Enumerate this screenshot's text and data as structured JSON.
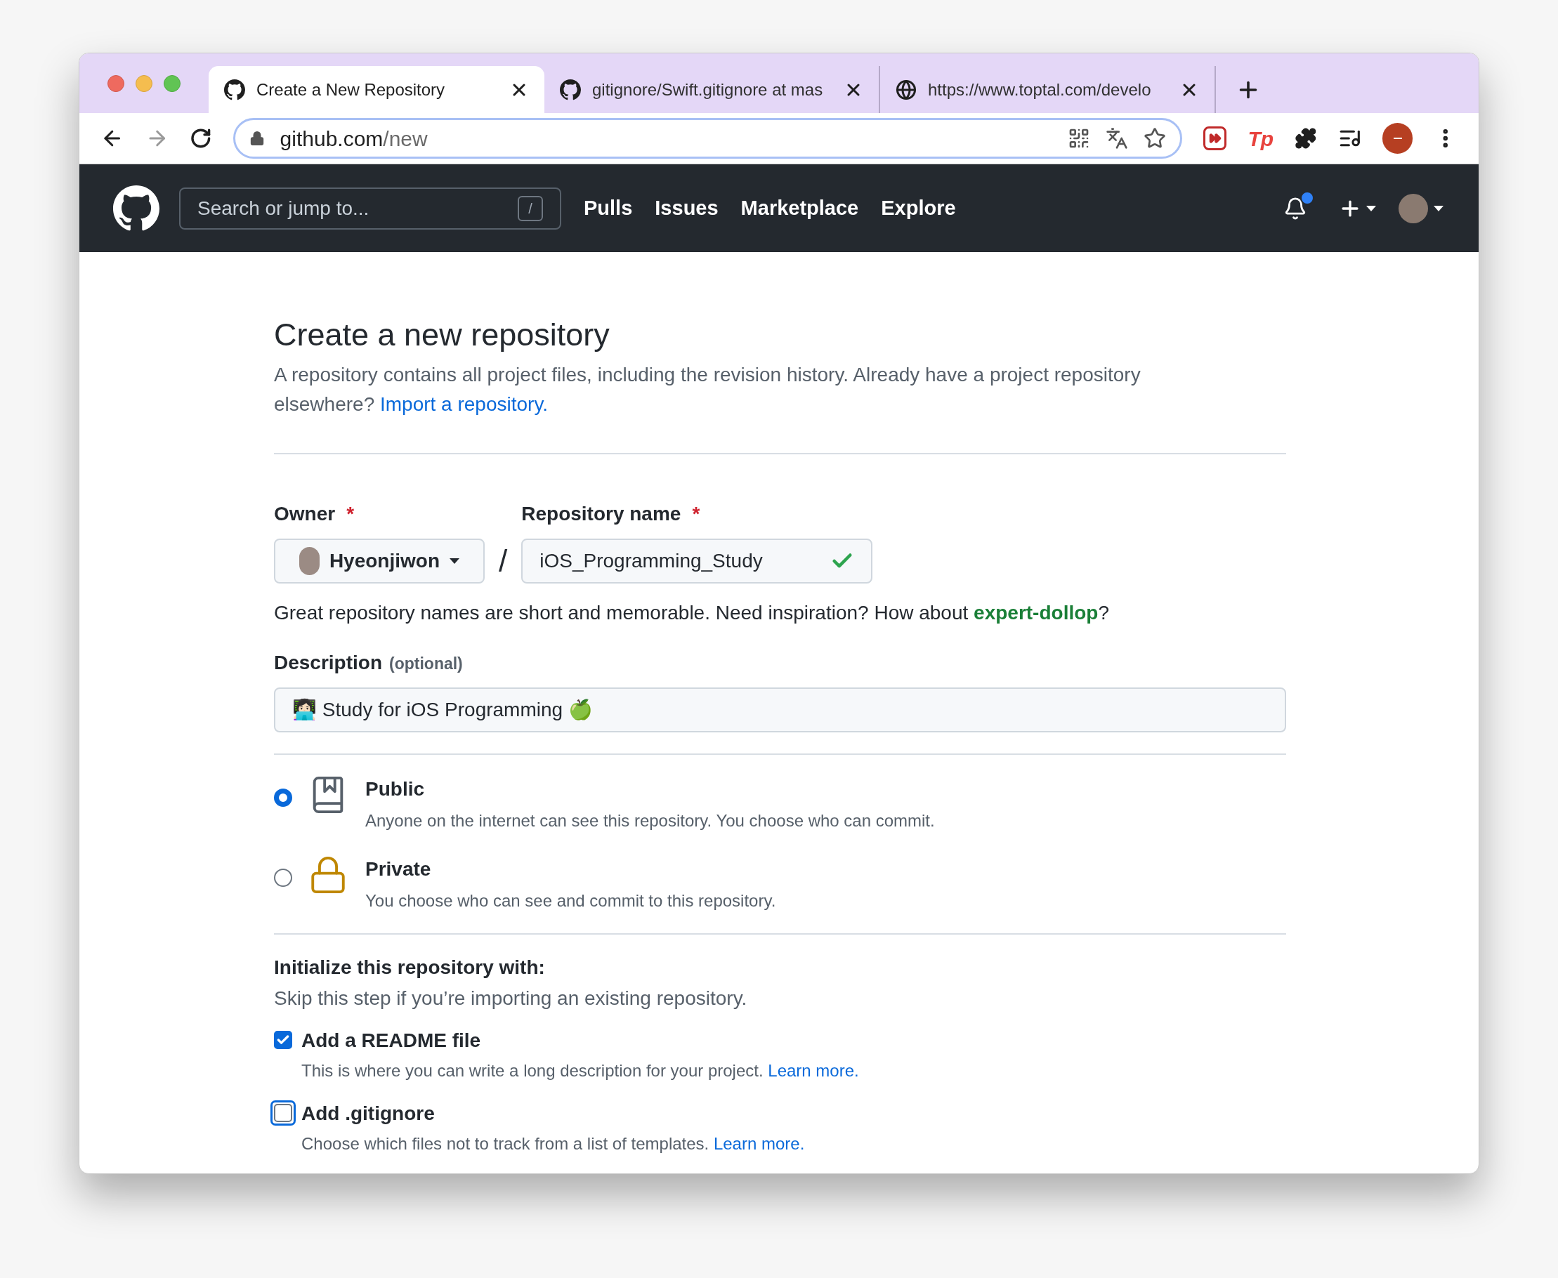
{
  "browser": {
    "tabs": [
      {
        "title": "Create a New Repository",
        "kind": "github",
        "selected": true
      },
      {
        "title": "gitignore/Swift.gitignore at mas",
        "kind": "github",
        "selected": false
      },
      {
        "title": "https://www.toptal.com/develo",
        "kind": "globe",
        "selected": false
      }
    ],
    "address": {
      "host": "github.com",
      "path": "/new"
    },
    "extension_label": "Tp"
  },
  "header": {
    "search_placeholder": "Search or jump to...",
    "shortcut_key": "/",
    "nav": [
      "Pulls",
      "Issues",
      "Marketplace",
      "Explore"
    ],
    "notifications_unread": true
  },
  "page": {
    "title": "Create a new repository",
    "intro": "A repository contains all project files, including the revision history. Already have a project repository elsewhere?",
    "import_link": "Import a repository.",
    "owner": {
      "label": "Owner",
      "required_mark": "*",
      "value": "Hyeonjiwon"
    },
    "separator": "/",
    "repository_name": {
      "label": "Repository name",
      "required_mark": "*",
      "value": "iOS_Programming_Study",
      "valid": true
    },
    "hint": {
      "before": "Great repository names are short and memorable. Need inspiration? How about",
      "suggestion": "expert-dollop",
      "after": "?"
    },
    "description": {
      "label": "Description",
      "optional": "(optional)",
      "value": "👩🏻‍💻 Study for iOS Programming 🍏"
    },
    "visibility": [
      {
        "title": "Public",
        "description": "Anyone on the internet can see this repository. You choose who can commit.",
        "kind": "book",
        "selected": true
      },
      {
        "title": "Private",
        "description": "You choose who can see and commit to this repository.",
        "kind": "lock",
        "selected": false
      }
    ],
    "initialize": {
      "title": "Initialize this repository with:",
      "subtitle": "Skip this step if you’re importing an existing repository."
    },
    "init_options": [
      {
        "label": "Add a README file",
        "description": "This is where you can write a long description for your project.",
        "link": "Learn more.",
        "checked": true,
        "focused": false
      },
      {
        "label": "Add .gitignore",
        "description": "Choose which files not to track from a list of templates.",
        "link": "Learn more.",
        "checked": false,
        "focused": true
      }
    ]
  }
}
